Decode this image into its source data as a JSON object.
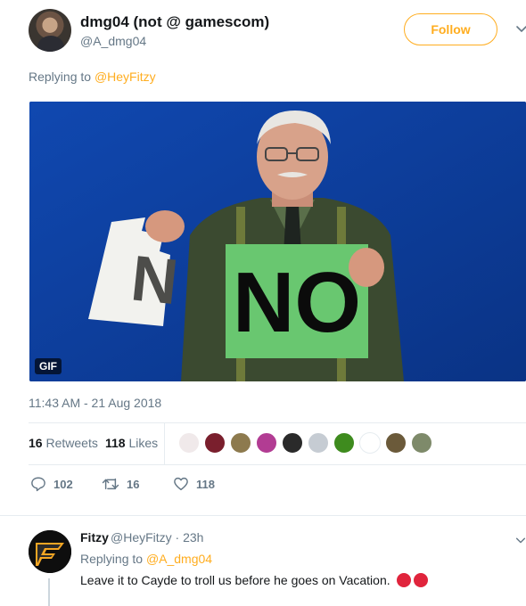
{
  "tweet": {
    "author_name": "dmg04 (not @ gamescom)",
    "author_handle": "@A_dmg04",
    "follow_label": "Follow",
    "replying_prefix": "Replying to ",
    "replying_to": "@HeyFitzy",
    "media_badge": "GIF",
    "gif_sign_text": "NO",
    "gif_torn_sign_text": "N",
    "timestamp": "11:43 AM - 21 Aug 2018",
    "retweets_count": "16",
    "retweets_label": "Retweets",
    "likes_count": "118",
    "likes_label": "Likes",
    "actions": {
      "reply_count": "102",
      "retweet_count": "16",
      "like_count": "118"
    }
  },
  "reply": {
    "author_name": "Fitzy",
    "author_handle": "@HeyFitzy · 23h",
    "replying_prefix": "Replying to ",
    "replying_to": "@A_dmg04",
    "text": "Leave it to Cayde to troll us before he goes on Vacation."
  },
  "colors": {
    "accent": "#ffad1f",
    "secondary_text": "#657786",
    "primary_text": "#14171a",
    "divider": "#e6ecf0",
    "gif_background": "#0f3f9e"
  },
  "icons": {
    "caret": "chevron-down-icon",
    "reply": "reply-icon",
    "retweet": "retweet-icon",
    "like": "heart-icon"
  }
}
